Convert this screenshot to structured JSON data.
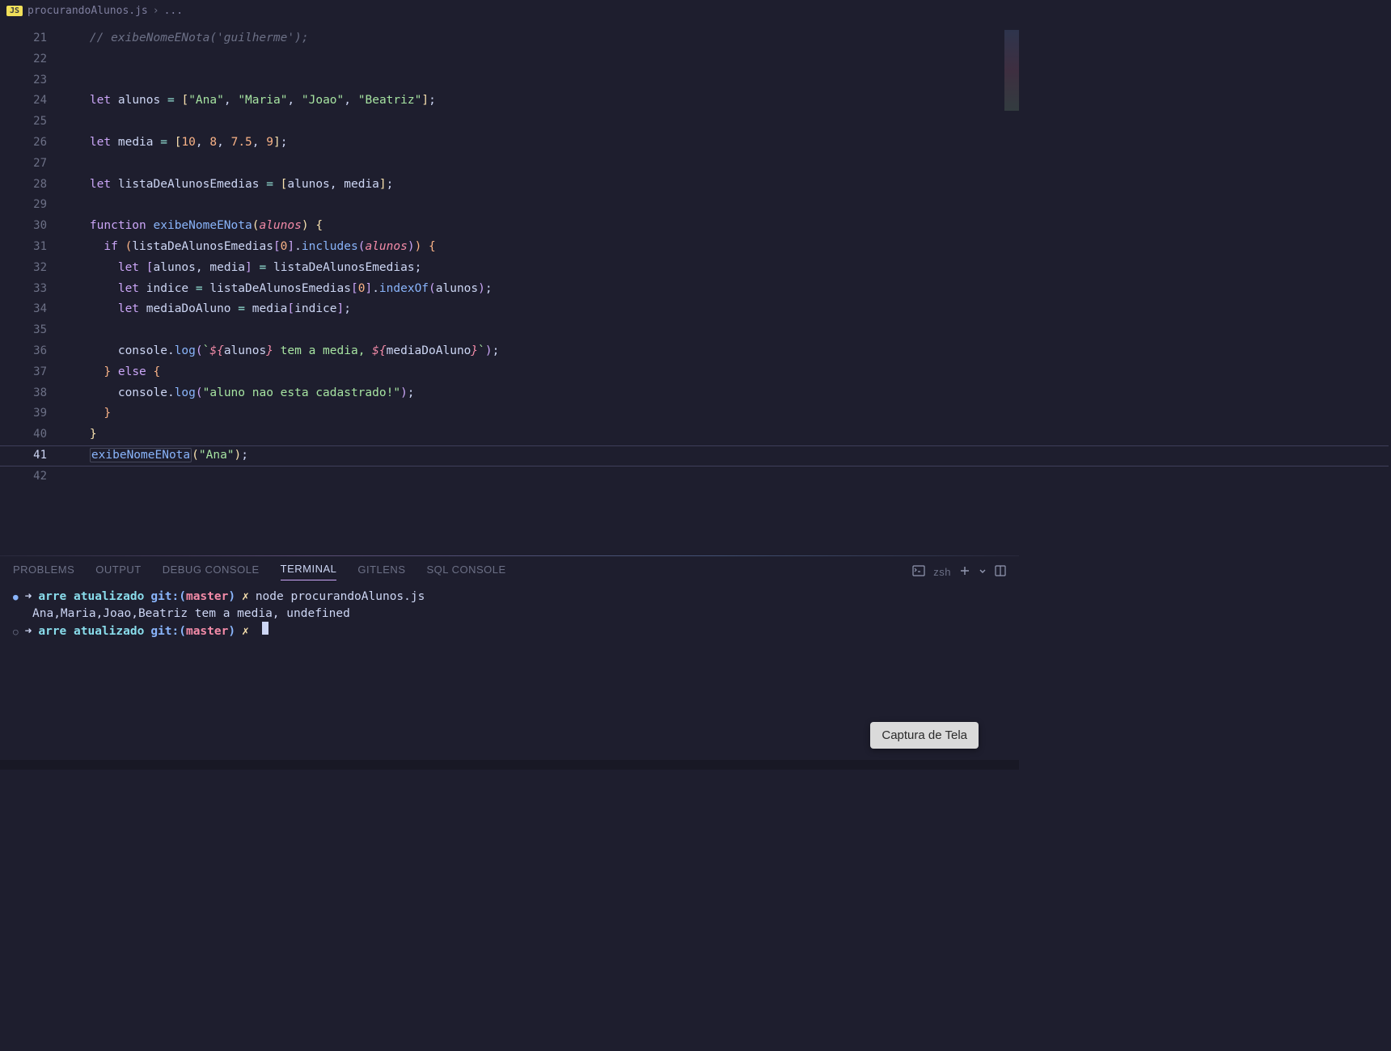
{
  "breadcrumb": {
    "icon_text": "JS",
    "filename": "procurandoAlunos.js",
    "more": "..."
  },
  "gutter": {
    "start": 21,
    "end": 42,
    "current": 41
  },
  "code": [
    {
      "n": 21,
      "tokens": [
        [
          "pl",
          "    "
        ],
        [
          "cm",
          "// exibeNomeENota('guilherme');"
        ]
      ]
    },
    {
      "n": 22,
      "tokens": []
    },
    {
      "n": 23,
      "tokens": []
    },
    {
      "n": 24,
      "tokens": [
        [
          "pl",
          "    "
        ],
        [
          "kw",
          "let"
        ],
        [
          "pl",
          " "
        ],
        [
          "id",
          "alunos"
        ],
        [
          "pl",
          " "
        ],
        [
          "op",
          "="
        ],
        [
          "pl",
          " "
        ],
        [
          "br",
          "["
        ],
        [
          "st2",
          "\"Ana\""
        ],
        [
          "pl",
          ", "
        ],
        [
          "st2",
          "\"Maria\""
        ],
        [
          "pl",
          ", "
        ],
        [
          "st2",
          "\"Joao\""
        ],
        [
          "pl",
          ", "
        ],
        [
          "st2",
          "\"Beatriz\""
        ],
        [
          "br",
          "]"
        ],
        [
          "pl",
          ";"
        ]
      ]
    },
    {
      "n": 25,
      "tokens": []
    },
    {
      "n": 26,
      "tokens": [
        [
          "pl",
          "    "
        ],
        [
          "kw",
          "let"
        ],
        [
          "pl",
          " "
        ],
        [
          "id",
          "media"
        ],
        [
          "pl",
          " "
        ],
        [
          "op",
          "="
        ],
        [
          "pl",
          " "
        ],
        [
          "br",
          "["
        ],
        [
          "nm",
          "10"
        ],
        [
          "pl",
          ", "
        ],
        [
          "nm",
          "8"
        ],
        [
          "pl",
          ", "
        ],
        [
          "nm",
          "7.5"
        ],
        [
          "pl",
          ", "
        ],
        [
          "nm",
          "9"
        ],
        [
          "br",
          "]"
        ],
        [
          "pl",
          ";"
        ]
      ]
    },
    {
      "n": 27,
      "tokens": []
    },
    {
      "n": 28,
      "tokens": [
        [
          "pl",
          "    "
        ],
        [
          "kw",
          "let"
        ],
        [
          "pl",
          " "
        ],
        [
          "id",
          "listaDeAlunosEmedias"
        ],
        [
          "pl",
          " "
        ],
        [
          "op",
          "="
        ],
        [
          "pl",
          " "
        ],
        [
          "br",
          "["
        ],
        [
          "id",
          "alunos"
        ],
        [
          "pl",
          ", "
        ],
        [
          "id",
          "media"
        ],
        [
          "br",
          "]"
        ],
        [
          "pl",
          ";"
        ]
      ]
    },
    {
      "n": 29,
      "tokens": []
    },
    {
      "n": 30,
      "tokens": [
        [
          "pl",
          "    "
        ],
        [
          "kw",
          "function"
        ],
        [
          "pl",
          " "
        ],
        [
          "fn",
          "exibeNomeENota"
        ],
        [
          "br",
          "("
        ],
        [
          "tp",
          "alunos"
        ],
        [
          "br",
          ")"
        ],
        [
          "pl",
          " "
        ],
        [
          "br",
          "{"
        ]
      ]
    },
    {
      "n": 31,
      "tokens": [
        [
          "pl",
          "      "
        ],
        [
          "kw",
          "if"
        ],
        [
          "pl",
          " "
        ],
        [
          "br1",
          "("
        ],
        [
          "id",
          "listaDeAlunosEmedias"
        ],
        [
          "br2",
          "["
        ],
        [
          "nm",
          "0"
        ],
        [
          "br2",
          "]"
        ],
        [
          "pl",
          "."
        ],
        [
          "fn2",
          "includes"
        ],
        [
          "br2",
          "("
        ],
        [
          "tp",
          "alunos"
        ],
        [
          "br2",
          ")"
        ],
        [
          "br1",
          ")"
        ],
        [
          "pl",
          " "
        ],
        [
          "br1",
          "{"
        ]
      ]
    },
    {
      "n": 32,
      "tokens": [
        [
          "pl",
          "        "
        ],
        [
          "kw",
          "let"
        ],
        [
          "pl",
          " "
        ],
        [
          "br2",
          "["
        ],
        [
          "id",
          "alunos"
        ],
        [
          "pl",
          ", "
        ],
        [
          "id",
          "media"
        ],
        [
          "br2",
          "]"
        ],
        [
          "pl",
          " "
        ],
        [
          "op",
          "="
        ],
        [
          "pl",
          " "
        ],
        [
          "id",
          "listaDeAlunosEmedias"
        ],
        [
          "pl",
          ";"
        ]
      ]
    },
    {
      "n": 33,
      "tokens": [
        [
          "pl",
          "        "
        ],
        [
          "kw",
          "let"
        ],
        [
          "pl",
          " "
        ],
        [
          "id",
          "indice"
        ],
        [
          "pl",
          " "
        ],
        [
          "op",
          "="
        ],
        [
          "pl",
          " "
        ],
        [
          "id",
          "listaDeAlunosEmedias"
        ],
        [
          "br2",
          "["
        ],
        [
          "nm",
          "0"
        ],
        [
          "br2",
          "]"
        ],
        [
          "pl",
          "."
        ],
        [
          "fn2",
          "indexOf"
        ],
        [
          "br2",
          "("
        ],
        [
          "id",
          "alunos"
        ],
        [
          "br2",
          ")"
        ],
        [
          "pl",
          ";"
        ]
      ]
    },
    {
      "n": 34,
      "tokens": [
        [
          "pl",
          "        "
        ],
        [
          "kw",
          "let"
        ],
        [
          "pl",
          " "
        ],
        [
          "id",
          "mediaDoAluno"
        ],
        [
          "pl",
          " "
        ],
        [
          "op",
          "="
        ],
        [
          "pl",
          " "
        ],
        [
          "id",
          "media"
        ],
        [
          "br2",
          "["
        ],
        [
          "id",
          "indice"
        ],
        [
          "br2",
          "]"
        ],
        [
          "pl",
          ";"
        ]
      ]
    },
    {
      "n": 35,
      "tokens": []
    },
    {
      "n": 36,
      "tokens": [
        [
          "pl",
          "        "
        ],
        [
          "id",
          "console"
        ],
        [
          "pl",
          "."
        ],
        [
          "fn2",
          "log"
        ],
        [
          "br2",
          "("
        ],
        [
          "st2",
          "`"
        ],
        [
          "tp",
          "${"
        ],
        [
          "id",
          "alunos"
        ],
        [
          "tp",
          "}"
        ],
        [
          "st2",
          " tem a media, "
        ],
        [
          "tp",
          "${"
        ],
        [
          "id",
          "mediaDoAluno"
        ],
        [
          "tp",
          "}"
        ],
        [
          "st2",
          "`"
        ],
        [
          "br2",
          ")"
        ],
        [
          "pl",
          ";"
        ]
      ]
    },
    {
      "n": 37,
      "tokens": [
        [
          "pl",
          "      "
        ],
        [
          "br1",
          "}"
        ],
        [
          "pl",
          " "
        ],
        [
          "kw",
          "else"
        ],
        [
          "pl",
          " "
        ],
        [
          "br1",
          "{"
        ]
      ]
    },
    {
      "n": 38,
      "tokens": [
        [
          "pl",
          "        "
        ],
        [
          "id",
          "console"
        ],
        [
          "pl",
          "."
        ],
        [
          "fn2",
          "log"
        ],
        [
          "br2",
          "("
        ],
        [
          "st2",
          "\"aluno nao esta cadastrado!\""
        ],
        [
          "br2",
          ")"
        ],
        [
          "pl",
          ";"
        ]
      ]
    },
    {
      "n": 39,
      "tokens": [
        [
          "pl",
          "      "
        ],
        [
          "br1",
          "}"
        ]
      ]
    },
    {
      "n": 40,
      "tokens": [
        [
          "pl",
          "    "
        ],
        [
          "br",
          "}"
        ]
      ]
    },
    {
      "n": 41,
      "current": true,
      "tokens": [
        [
          "pl",
          "    "
        ],
        [
          "fn",
          "exibeNomeENota",
          "word-sel"
        ],
        [
          "br",
          "("
        ],
        [
          "st2",
          "\"Ana\""
        ],
        [
          "br",
          ")"
        ],
        [
          "pl",
          ";"
        ]
      ]
    },
    {
      "n": 42,
      "tokens": []
    }
  ],
  "panel": {
    "tabs": [
      {
        "label": "PROBLEMS",
        "active": false
      },
      {
        "label": "OUTPUT",
        "active": false
      },
      {
        "label": "DEBUG CONSOLE",
        "active": false
      },
      {
        "label": "TERMINAL",
        "active": true
      },
      {
        "label": "GITLENS",
        "active": false
      },
      {
        "label": "SQL CONSOLE",
        "active": false
      }
    ],
    "shell": "zsh"
  },
  "terminal": {
    "lines": [
      {
        "type": "prompt",
        "bullet": "fill",
        "dir": "arre atualizado",
        "git": "git:(",
        "branch": "master",
        "git2": ")",
        "x": "✗",
        "cmd": "node procurandoAlunos.js"
      },
      {
        "type": "output",
        "text": "Ana,Maria,Joao,Beatriz tem a media, undefined"
      },
      {
        "type": "prompt",
        "bullet": "open",
        "dir": "arre atualizado",
        "git": "git:(",
        "branch": "master",
        "git2": ")",
        "x": "✗",
        "cmd": "",
        "cursor": true
      }
    ]
  },
  "tooltip": {
    "text": "Captura de Tela"
  }
}
